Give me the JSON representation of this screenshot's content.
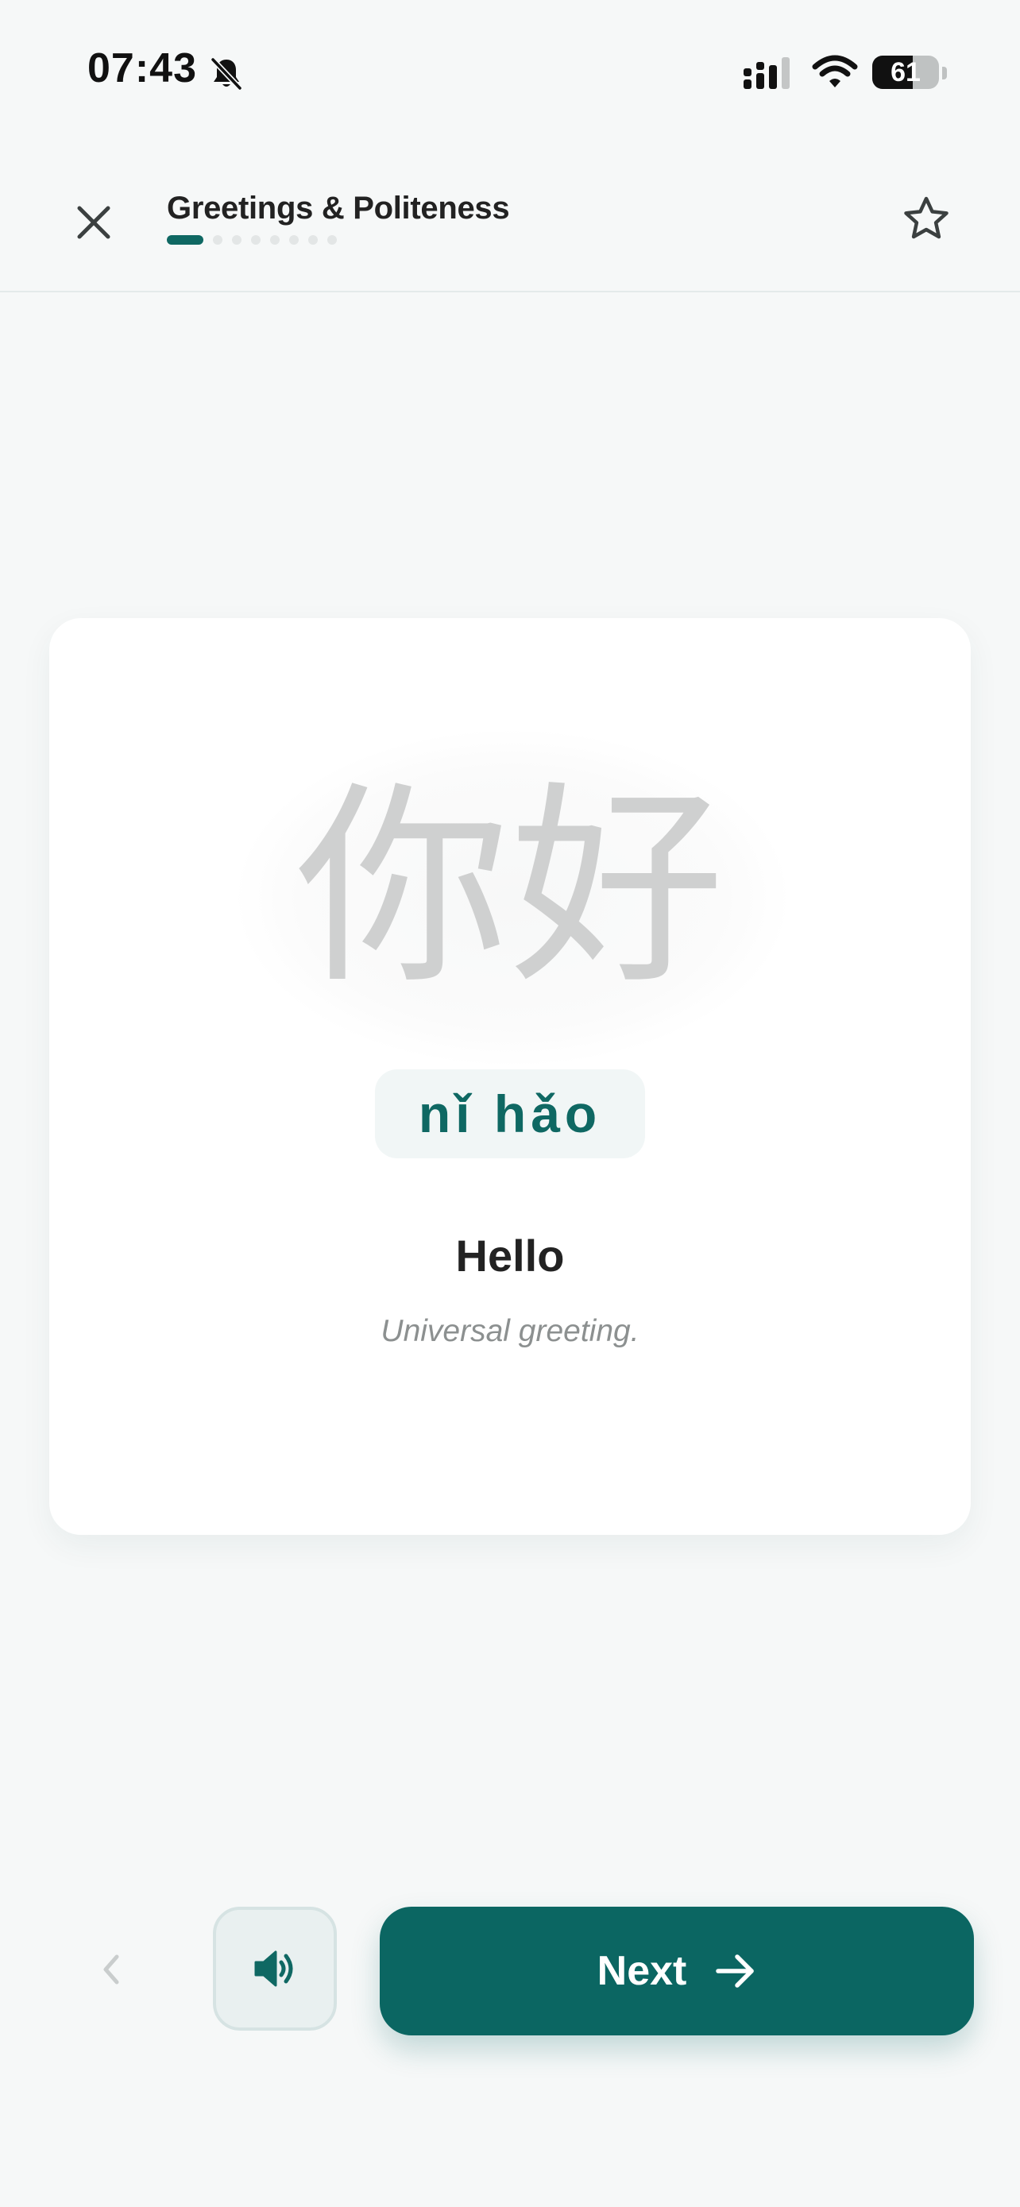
{
  "status_bar": {
    "time": "07:43",
    "battery_level": "61",
    "icons": [
      "bell-slash-icon",
      "signal-icon",
      "wifi-icon",
      "battery-icon"
    ]
  },
  "header": {
    "title": "Greetings & Politeness",
    "close_icon": "close-icon",
    "favorite_icon": "star-outline-icon",
    "progress": {
      "current": 1,
      "total": 8
    }
  },
  "card": {
    "hanzi": "你好",
    "pinyin": "nǐ hǎo",
    "meaning": "Hello",
    "note": "Universal greeting."
  },
  "controls": {
    "previous_icon": "chevron-left-icon",
    "audio_icon": "speaker-icon",
    "next_label": "Next",
    "next_icon": "arrow-right-icon"
  },
  "colors": {
    "accent": "#0b6662",
    "background": "#f6f8f8",
    "card": "#ffffff",
    "hanzi": "#cfd0d0",
    "muted": "#8c9090"
  }
}
